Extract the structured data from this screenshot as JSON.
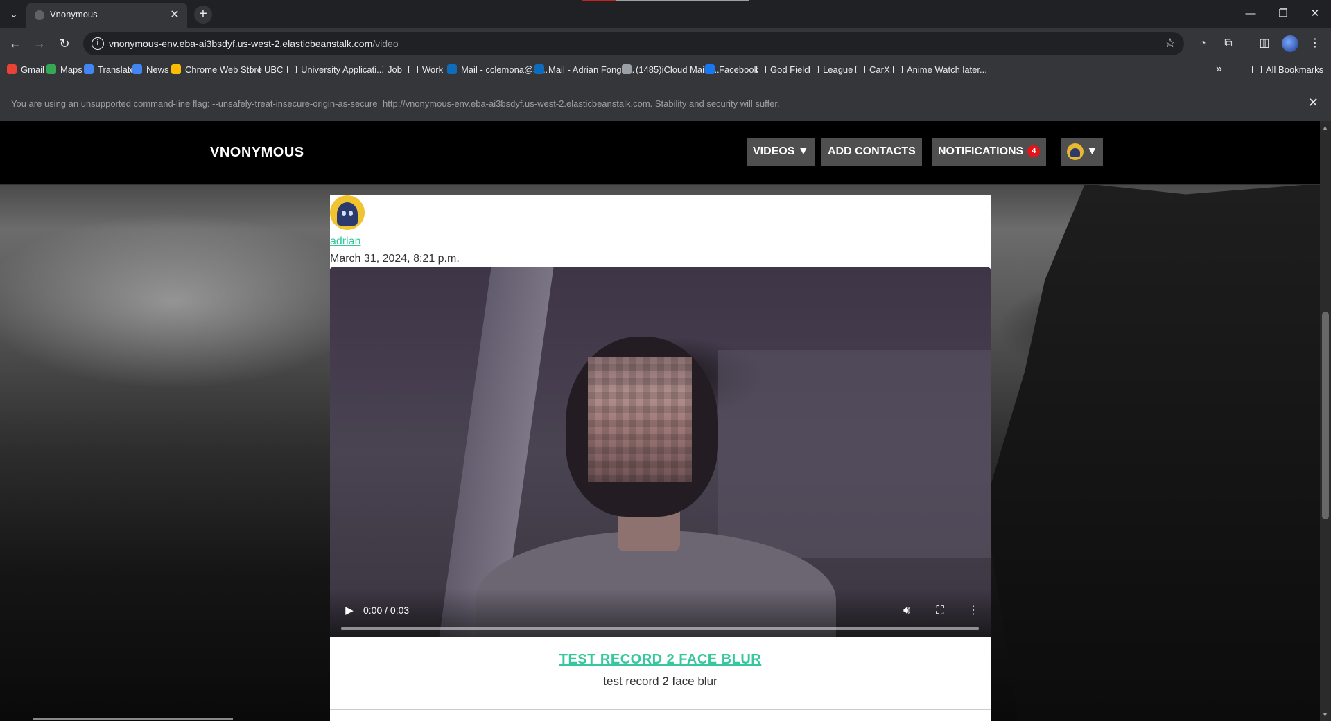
{
  "browser": {
    "tab_title": "Vnonymous",
    "url_host": "vnonymous-env.eba-ai3bsdyf.us-west-2.elasticbeanstalk.com",
    "url_path": "/video",
    "bookmarks": [
      {
        "label": "Gmail",
        "type": "site",
        "color": "#ea4335"
      },
      {
        "label": "Maps",
        "type": "site",
        "color": "#34a853"
      },
      {
        "label": "Translate",
        "type": "site",
        "color": "#4285f4"
      },
      {
        "label": "News",
        "type": "site",
        "color": "#4285f4"
      },
      {
        "label": "Chrome Web Store",
        "type": "site",
        "color": "#fbbc04"
      },
      {
        "label": "UBC",
        "type": "folder"
      },
      {
        "label": "University Applicati...",
        "type": "folder"
      },
      {
        "label": "Job",
        "type": "folder"
      },
      {
        "label": "Work",
        "type": "folder"
      },
      {
        "label": "Mail - cclemona@st...",
        "type": "site",
        "color": "#0f6cbd"
      },
      {
        "label": "Mail - Adrian Fong -...",
        "type": "site",
        "color": "#0f6cbd"
      },
      {
        "label": "(1485)iCloud Mail -...",
        "type": "site",
        "color": "#9aa0a6"
      },
      {
        "label": "Facebook",
        "type": "site",
        "color": "#1877f2"
      },
      {
        "label": "God Field",
        "type": "folder"
      },
      {
        "label": "League",
        "type": "folder"
      },
      {
        "label": "CarX",
        "type": "folder"
      },
      {
        "label": "Anime Watch later...",
        "type": "folder"
      }
    ],
    "bookmarks_overflow": "»",
    "all_bookmarks": "All Bookmarks",
    "infobar_text": "You are using an unsupported command-line flag: --unsafely-treat-insecure-origin-as-secure=http://vnonymous-env.eba-ai3bsdyf.us-west-2.elasticbeanstalk.com. Stability and security will suffer."
  },
  "site": {
    "brand": "VNONYMOUS",
    "nav": {
      "videos": "VIDEOS ▼",
      "add_contacts": "ADD CONTACTS",
      "notifications": "NOTIFICATIONS",
      "notification_count": "4",
      "profile_caret": "▼"
    }
  },
  "post": {
    "author": "adrian",
    "date": "March 31, 2024, 8:21 p.m.",
    "video": {
      "time": "0:00 / 0:03",
      "progress_fraction": 0
    },
    "title": "TEST RECORD 2 FACE BLUR",
    "description": "test record 2 face blur"
  }
}
